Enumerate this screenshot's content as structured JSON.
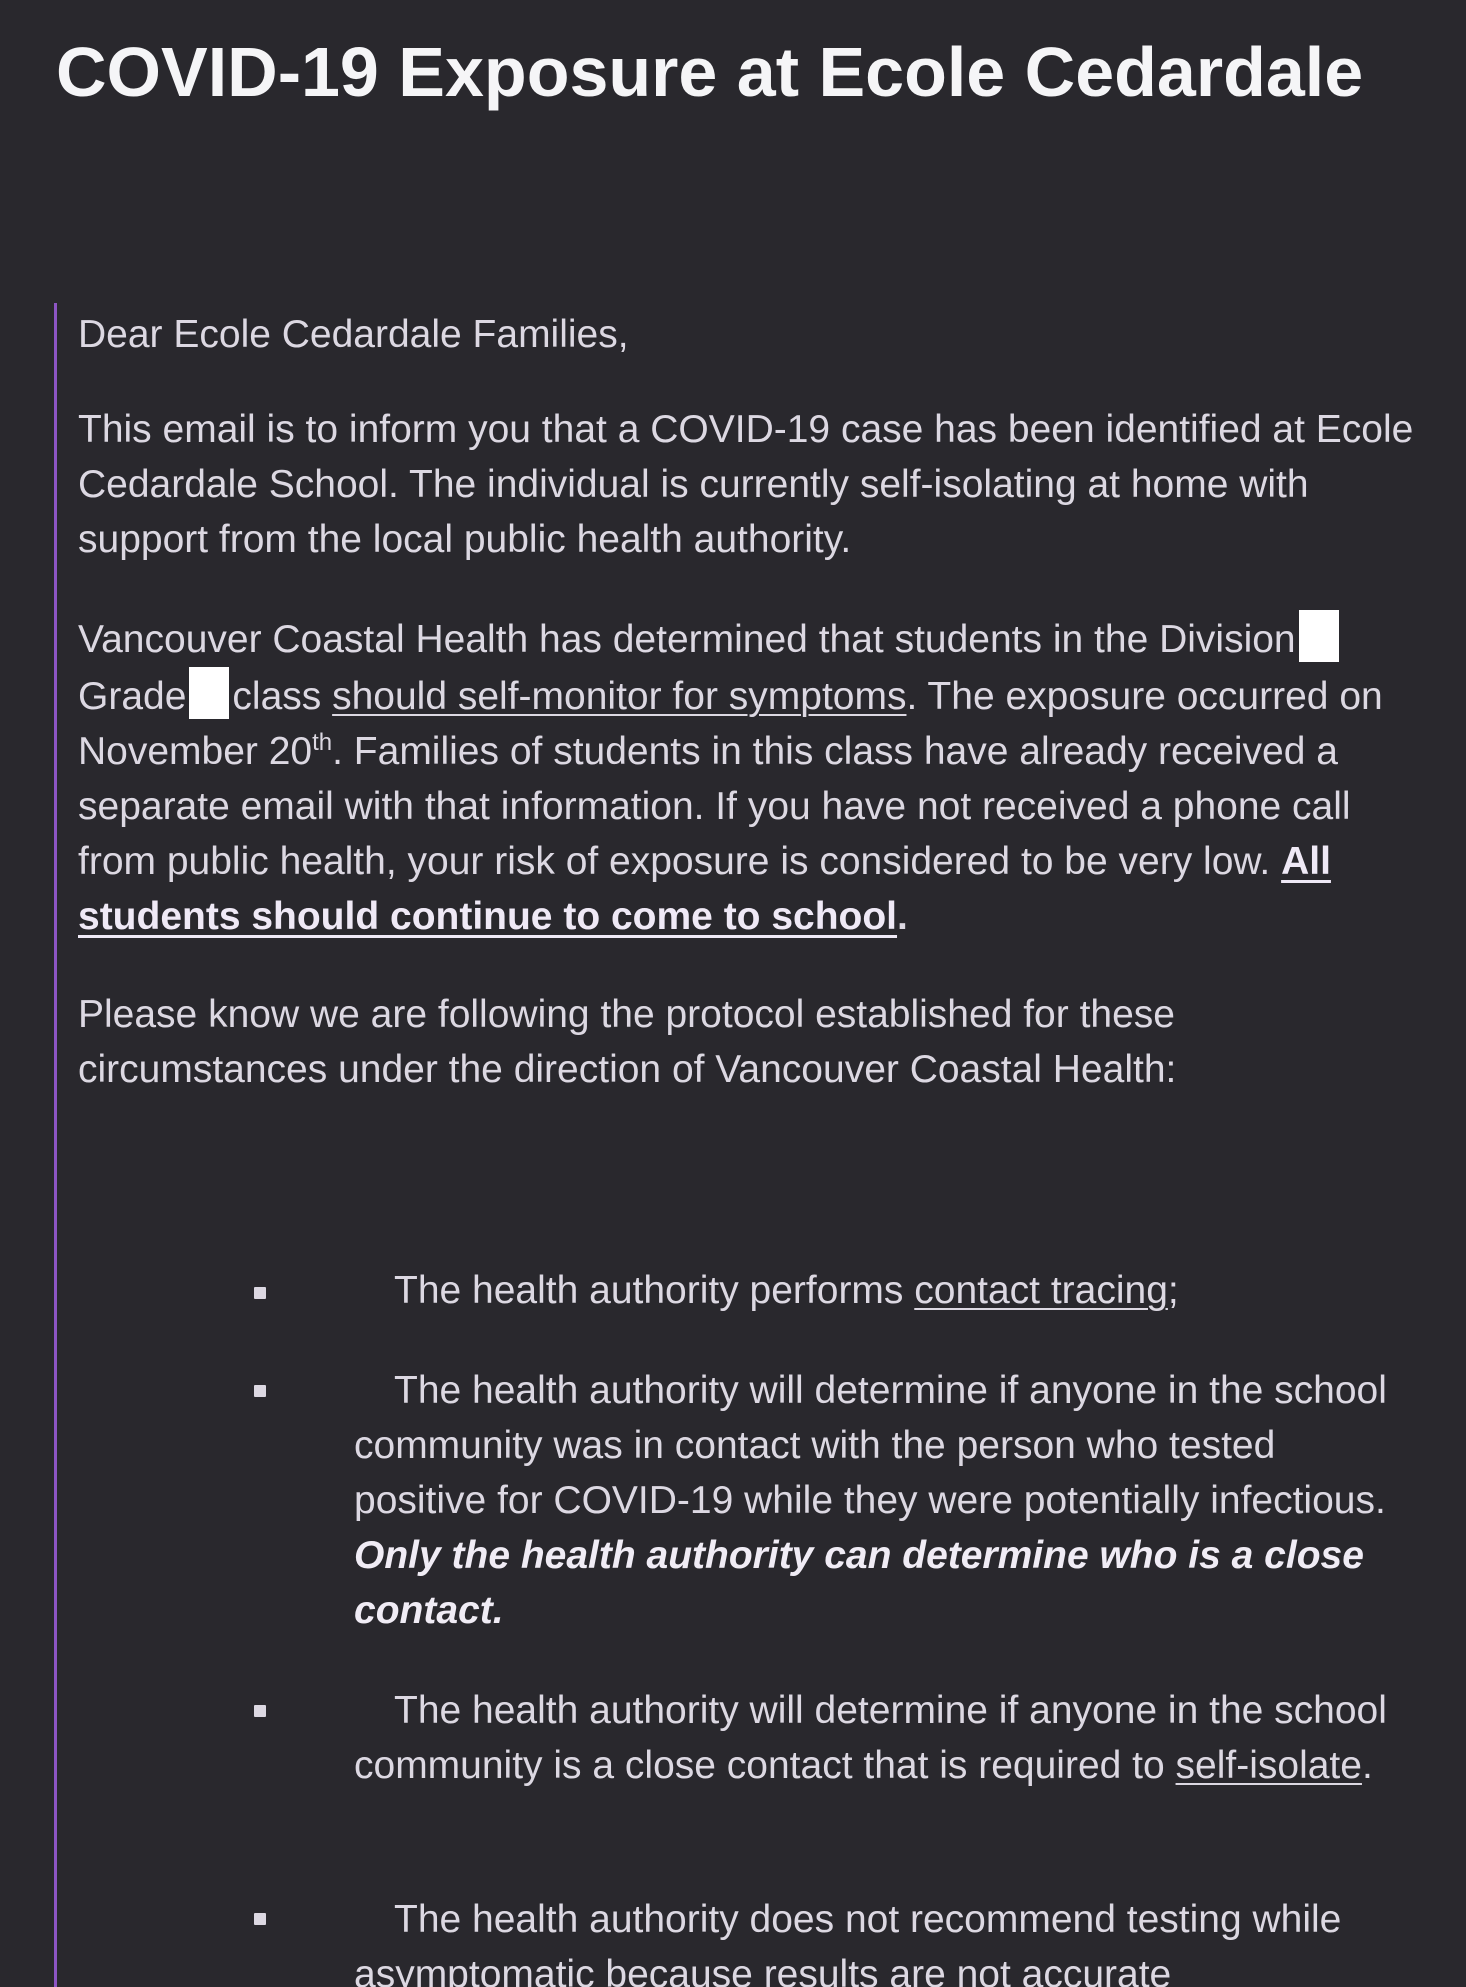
{
  "email": {
    "subject": "COVID-19 Exposure at Ecole Cedardale",
    "greeting": "Dear Ecole Cedardale Families,",
    "paragraph1": "This email is to inform you that a COVID-19 case has been identified at Ecole Cedardale School. The individual is currently self-isolating at home with support from the local public health authority.",
    "paragraph2": {
      "part1": "Vancouver Coastal Health has determined that students in the Division",
      "part2": "Grade",
      "part3": "class",
      "link_self_monitor": "should self-monitor for symptoms",
      "part4": ". The exposure occurred on November 20",
      "sup_th": "th",
      "part5": ". Families of students in this class have already received a separate email with that information. If you have not received a phone call from public health, your risk of exposure is considered to be very low.",
      "emphasis_link": "All students should continue to come to school",
      "part6": "."
    },
    "paragraph3": "Please know we are following the protocol established for these circumstances under the direction of Vancouver Coastal Health:",
    "bullets": {
      "b1_text": "The health authority performs",
      "b1_link": "contact tracing",
      "b1_end": ";",
      "b2_text": "The health authority will determine if anyone in the school community was in contact with the person who tested positive for COVID-19 while they were potentially infectious.",
      "b2_emphasis": "Only the health authority can determine who is a close contact.",
      "b3_text": "The health authority will determine if anyone in the school community is a close contact that is required to",
      "b3_link": "self-isolate",
      "b3_end": ".",
      "b4_text": "The health authority does not recommend testing while asymptomatic because results are not accurate"
    }
  }
}
